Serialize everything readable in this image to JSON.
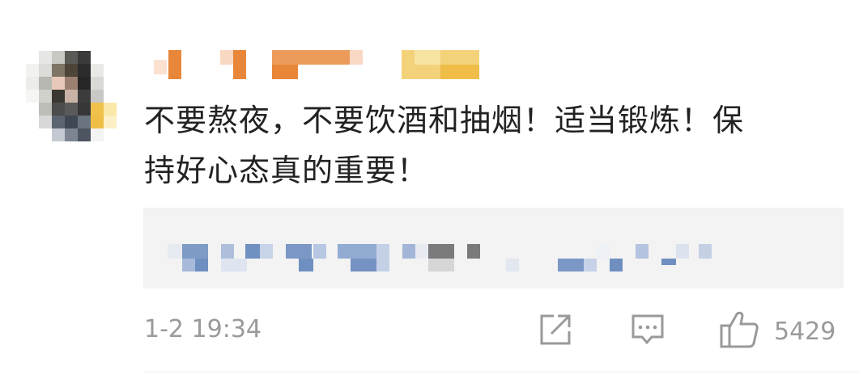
{
  "comment": {
    "body_line1": "不要熬夜，不要饮酒和抽烟！适当锻炼！保",
    "body_line2": "持好心态真的重要！",
    "timestamp": "1-2 19:34",
    "like_count": "5429"
  },
  "icons": {
    "share": "share-icon",
    "comment": "comment-icon",
    "like": "thumbs-up-icon"
  },
  "colors": {
    "text": "#222222",
    "meta": "#9a9a9a",
    "reply_bg": "#f3f3f3",
    "username_orange": "#e8873a",
    "username_yellow": "#f0c14b",
    "reply_link_blue": "#6f8fc0"
  }
}
